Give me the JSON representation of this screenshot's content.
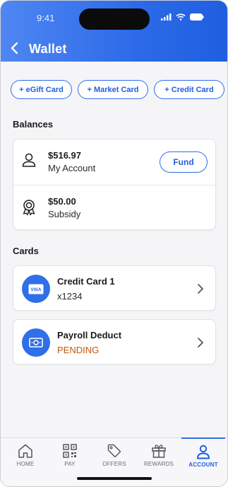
{
  "status": {
    "time": "9:41"
  },
  "header": {
    "title": "Wallet"
  },
  "actions": [
    {
      "label": "+ eGift Card"
    },
    {
      "label": "+ Market Card"
    },
    {
      "label": "+ Credit Card"
    }
  ],
  "balances": {
    "title": "Balances",
    "items": [
      {
        "amount": "$516.97",
        "label": "My Account",
        "icon": "user-icon"
      },
      {
        "amount": "$50.00",
        "label": "Subsidy",
        "icon": "award-ribbon-icon"
      }
    ],
    "fund_label": "Fund"
  },
  "cards": {
    "title": "Cards",
    "items": [
      {
        "title": "Credit Card 1",
        "subtitle": "x1234",
        "icon": "visa-card-icon",
        "badge_text": "VISA"
      },
      {
        "title": "Payroll Deduct",
        "subtitle": "PENDING",
        "icon": "cash-icon"
      }
    ]
  },
  "tabs": [
    {
      "label": "HOME",
      "icon": "home-icon",
      "active": false
    },
    {
      "label": "PAY",
      "icon": "qr-code-icon",
      "active": false
    },
    {
      "label": "OFFERS",
      "icon": "tag-icon",
      "active": false
    },
    {
      "label": "REWARDS",
      "icon": "gift-icon",
      "active": false
    },
    {
      "label": "ACCOUNT",
      "icon": "person-icon",
      "active": true
    }
  ],
  "colors": {
    "accent": "#2f6fe8",
    "header_start": "#4f86f2",
    "header_end": "#1f5fe0",
    "pending": "#c1570b"
  }
}
